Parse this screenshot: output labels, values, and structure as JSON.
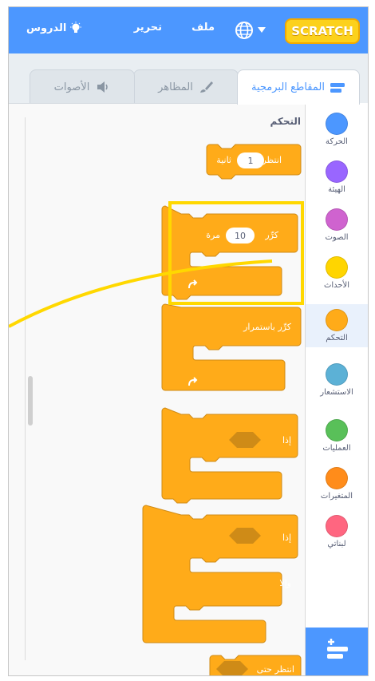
{
  "topbar": {
    "logo": "SCRATCH",
    "menu_file": "ملف",
    "menu_edit": "تحرير",
    "menu_tutorials": "الدروس"
  },
  "tabs": {
    "code": "المقاطع البرمجية",
    "costumes": "المظاهر",
    "sounds": "الأصوات"
  },
  "categories": [
    {
      "label": "الحركة",
      "color": "#4c97ff"
    },
    {
      "label": "الهيئة",
      "color": "#9966ff"
    },
    {
      "label": "الصوت",
      "color": "#cf63cf"
    },
    {
      "label": "الأحداث",
      "color": "#ffd500"
    },
    {
      "label": "التحكم",
      "color": "#ffab19"
    },
    {
      "label": "الاستشعار",
      "color": "#5cb1d6"
    },
    {
      "label": "العمليات",
      "color": "#59c059"
    },
    {
      "label": "المتغيرات",
      "color": "#ff8c1a"
    },
    {
      "label": "لبناتي",
      "color": "#ff6680"
    }
  ],
  "palette": {
    "heading": "التحكم",
    "wait": {
      "label": "انتظر",
      "value": "1",
      "unit": "ثانية"
    },
    "repeat": {
      "label": "كرِّر",
      "value": "10",
      "unit": "مرة"
    },
    "forever": {
      "label": "كرِّر باستمرار"
    },
    "if_then": {
      "label": "إذا"
    },
    "if_else": {
      "if_label": "إذا",
      "else_label": "وإلا"
    },
    "wait_until": {
      "label": "انتظر حتى"
    }
  },
  "colors": {
    "control_block": "#ffab19",
    "control_border": "#cf8b17",
    "highlight": "#ffd800",
    "accent": "#4c97ff"
  }
}
